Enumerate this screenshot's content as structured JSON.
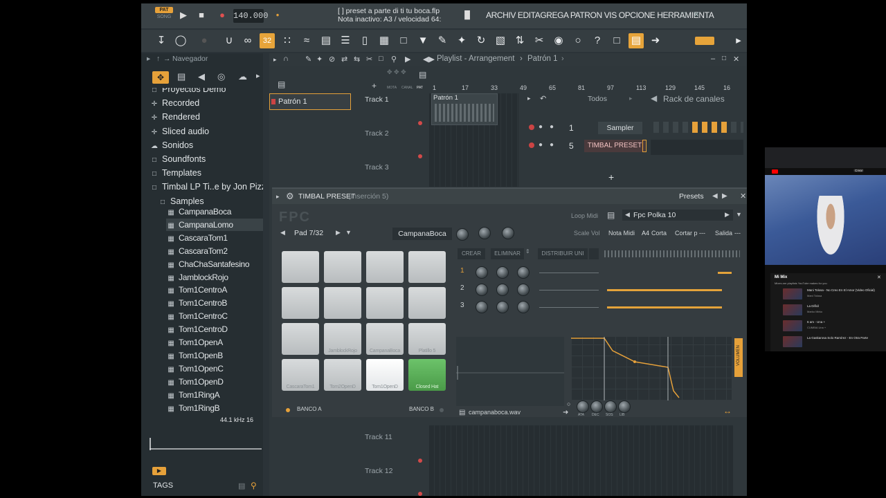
{
  "topbar": {
    "mode_pat": "PAT",
    "mode_song": "SONG",
    "tempo": "140.000",
    "file_title": "[   ] preset a parte di ti tu boca.flp",
    "note_status": "Nota inactivo: A3 / velocidad 64:",
    "menu": "ARCHIV EDITAGREGA PATRON  VIS OPCIONE HERRAMIENTA"
  },
  "toolbar": {
    "active_label": "32"
  },
  "browser": {
    "title": "Navegador",
    "items": [
      {
        "label": "Proyectos Demo",
        "icon": "folder-icon",
        "level": 0
      },
      {
        "label": "Recorded",
        "icon": "plus-icon",
        "level": 0
      },
      {
        "label": "Rendered",
        "icon": "plus-icon",
        "level": 0
      },
      {
        "label": "Sliced audio",
        "icon": "plus-icon",
        "level": 0
      },
      {
        "label": "Sonidos",
        "icon": "cloud-icon",
        "level": 0
      },
      {
        "label": "Soundfonts",
        "icon": "folder-icon",
        "level": 0
      },
      {
        "label": "Templates",
        "icon": "folder-icon",
        "level": 0
      },
      {
        "label": "Timbal LP Ti..e by Jon Pizzio",
        "icon": "folder-icon",
        "level": 0
      },
      {
        "label": "Samples",
        "icon": "folder-icon",
        "level": 1
      },
      {
        "label": "CampanaBoca",
        "icon": "file-icon",
        "level": 2
      },
      {
        "label": "CampanaLomo",
        "icon": "file-icon",
        "level": 2
      },
      {
        "label": "CascaraTom1",
        "icon": "file-icon",
        "level": 2
      },
      {
        "label": "CascaraTom2",
        "icon": "file-icon",
        "level": 2
      },
      {
        "label": "ChaChaSantafesino",
        "icon": "file-icon",
        "level": 2
      },
      {
        "label": "JamblockRojo",
        "icon": "file-icon",
        "level": 2
      },
      {
        "label": "Tom1CentroA",
        "icon": "file-icon",
        "level": 2
      },
      {
        "label": "Tom1CentroB",
        "icon": "file-icon",
        "level": 2
      },
      {
        "label": "Tom1CentroC",
        "icon": "file-icon",
        "level": 2
      },
      {
        "label": "Tom1CentroD",
        "icon": "file-icon",
        "level": 2
      },
      {
        "label": "Tom1OpenA",
        "icon": "file-icon",
        "level": 2
      },
      {
        "label": "Tom1OpenB",
        "icon": "file-icon",
        "level": 2
      },
      {
        "label": "Tom1OpenC",
        "icon": "file-icon",
        "level": 2
      },
      {
        "label": "Tom1OpenD",
        "icon": "file-icon",
        "level": 2
      },
      {
        "label": "Tom1RingA",
        "icon": "file-icon",
        "level": 2
      },
      {
        "label": "Tom1RingB",
        "icon": "file-icon",
        "level": 2
      }
    ],
    "sample_info": "44.1 kHz 16",
    "tags_label": "TAGS"
  },
  "playlist": {
    "title": "Playlist - Arrangement",
    "breadcrumb_sep": "›",
    "pattern_name": "Patrón 1",
    "pattern_item": "Patrón 1",
    "clip_label": "Patrón 1",
    "ruler": [
      "1",
      "17",
      "33",
      "49",
      "65",
      "81",
      "97",
      "113",
      "129",
      "145",
      "16"
    ],
    "tracks": [
      "Track 1",
      "Track 2",
      "Track 3",
      "Track 11",
      "Track 12"
    ],
    "small_labels": [
      "MOTA",
      "CANAL",
      "PAT"
    ]
  },
  "rack": {
    "filter": "Todos",
    "title": "Rack de canales",
    "channels": [
      {
        "number": "1",
        "name": "Sampler"
      },
      {
        "number": "5",
        "name": "TIMBAL PRESET"
      }
    ],
    "add": "+"
  },
  "plugin": {
    "title": "TIMBAL PRESET",
    "insert": "(Inserción 5)",
    "presets_label": "Presets",
    "loop_midi": "Loop Midi",
    "preset_name": "Fpc Polka 10",
    "pad_nav": "Pad 7/32",
    "pad_name": "CampanaBoca",
    "scale_vol": "Scale Vol",
    "nota_midi": "Nota Midi",
    "note_value": "A4",
    "corta": "Corta",
    "cortar_p": "Cortar p ---",
    "salida": "Salida",
    "salida_val": "---",
    "btn_crear": "CREAR",
    "btn_eliminar": "ELIMINAR",
    "btn_distribuir": "DISTRIBUIR UNI",
    "layers": [
      "1",
      "2",
      "3"
    ],
    "pads": [
      {
        "label": ""
      },
      {
        "label": ""
      },
      {
        "label": ""
      },
      {
        "label": ""
      },
      {
        "label": ""
      },
      {
        "label": ""
      },
      {
        "label": ""
      },
      {
        "label": ""
      },
      {
        "label": ""
      },
      {
        "label": "JamblockRojo"
      },
      {
        "label": "CampanaBoca"
      },
      {
        "label": "Platillo 5"
      },
      {
        "label": "CascaraTom1"
      },
      {
        "label": "Tom2OpenD"
      },
      {
        "label": "Tom1OpenD"
      },
      {
        "label": "Closed Hat"
      }
    ],
    "bank_a": "BANCO A",
    "bank_b": "BANCO B",
    "sample_file": "campanaboca.wav",
    "env_labels": [
      "ATA",
      "DEC",
      "SOS",
      "LIB"
    ],
    "volume_label": "VOLUMEN"
  },
  "youtube": {
    "mix_title": "Mi Mix",
    "mix_sub": "Mixes are playlists YouTube makes for you",
    "items": [
      {
        "title": "Mani Tolosa - No Creo En El Amor (Video Oficial)",
        "sub": "Mani Tolosa"
      },
      {
        "title": "La Difícil",
        "sub": "Marko Mirko"
      },
      {
        "title": "6 am - Una +",
        "sub": "CUMBIA Una +"
      },
      {
        "title": "La Gaskarosa  Solo Ramírez - En Otra Parte",
        "sub": ""
      }
    ],
    "chip": "Crear"
  },
  "colors": {
    "accent": "#e6a13a",
    "pad_green": "#5cb65a",
    "background": "#2b3338"
  }
}
